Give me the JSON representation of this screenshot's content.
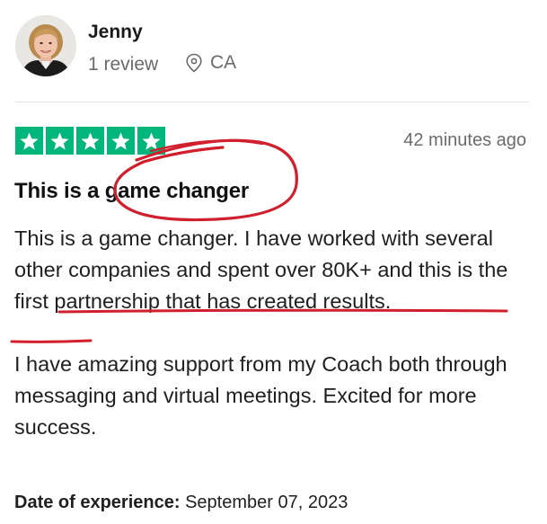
{
  "reviewer": {
    "name": "Jenny",
    "review_count": "1 review",
    "location": "CA",
    "avatar_icon": "reviewer-avatar"
  },
  "review": {
    "rating": 5,
    "rating_max": 5,
    "star_color": "#00b67a",
    "time_ago": "42 minutes ago",
    "title": "This is a game changer",
    "body_paragraph_1": "This is a game changer. I have worked with several other companies and spent over 80K+ and this is the first partnership that has created results.",
    "body_paragraph_2": "I have amazing support from my Coach both through messaging and virtual meetings. Excited for more success.",
    "date_label": "Date of experience:",
    "date_value": "September 07, 2023"
  },
  "annotation": {
    "color": "#d0202e"
  }
}
